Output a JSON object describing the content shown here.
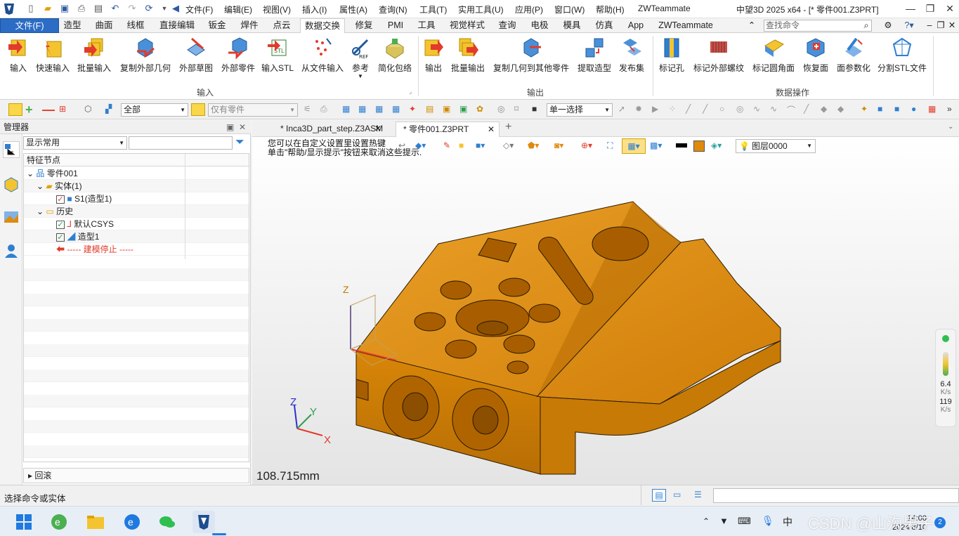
{
  "titlebar": {
    "menu": [
      "文件(F)",
      "编辑(E)",
      "视图(V)",
      "插入(I)",
      "属性(A)",
      "查询(N)",
      "工具(T)",
      "实用工具(U)",
      "应用(P)",
      "窗口(W)",
      "帮助(H)",
      "ZWTeammate"
    ],
    "title": "中望3D 2025 x64 - [* 零件001.Z3PRT]"
  },
  "tabs": {
    "file": "文件(F)",
    "items": [
      "造型",
      "曲面",
      "线框",
      "直接编辑",
      "钣金",
      "焊件",
      "点云",
      "数据交换",
      "修复",
      "PMI",
      "工具",
      "视觉样式",
      "查询",
      "电极",
      "模具",
      "仿真",
      "App",
      "ZWTeammate"
    ],
    "active": "数据交换",
    "search_placeholder": "查找命令"
  },
  "ribbon": {
    "input": [
      "输入",
      "快速输入",
      "批量输入",
      "复制外部几何",
      "外部草图",
      "外部零件",
      "输入STL",
      "从文件输入",
      "参考",
      "简化包络"
    ],
    "output": [
      "输出",
      "批量输出",
      "复制几何到其他零件",
      "提取造型",
      "发布集"
    ],
    "ops": [
      "标记孔",
      "标记外部螺纹",
      "标记圆角面",
      "恢复面",
      "面参数化",
      "分割STL文件"
    ],
    "groups": {
      "input": "输入",
      "output": "输出",
      "ops": "数据操作"
    }
  },
  "toolbar2": {
    "filter_value": "全部",
    "part_filter": "仅有零件",
    "select_mode": "单一选择"
  },
  "manager": {
    "title": "管理器",
    "display": "显示常用",
    "header": "特征节点",
    "nodes": [
      {
        "label": "零件001"
      },
      {
        "label": "实体(1)"
      },
      {
        "label": "S1(造型1)"
      },
      {
        "label": "历史"
      },
      {
        "label": "默认CSYS"
      },
      {
        "label": "造型1"
      },
      {
        "label": "----- 建模停止 -----"
      }
    ],
    "rollback": "回滚"
  },
  "doctabs": [
    "* Inca3D_part_step.Z3ASM",
    "* 零件001.Z3PRT"
  ],
  "viewport": {
    "hint_line1": "您可以在自定义设置里设置热键",
    "hint_line2": "单击\"帮助/显示提示\"按钮来取消这些提示.",
    "layer": "图层0000",
    "scale": "108.715mm",
    "axis_x": "X",
    "axis_y": "Y",
    "axis_z": "Z",
    "perf_up": "6.4",
    "perf_up_unit": "K/s",
    "perf_down": "119",
    "perf_down_unit": "K/s"
  },
  "status": {
    "text": "选择命令或实体"
  },
  "taskbar": {
    "time": "14:00",
    "date": "2024/8/10",
    "badge": "2"
  },
  "watermark": "CSDN @山沟果子",
  "colors": {
    "part": "#e08a0c",
    "ribbon_active": "#2b6cc4"
  }
}
